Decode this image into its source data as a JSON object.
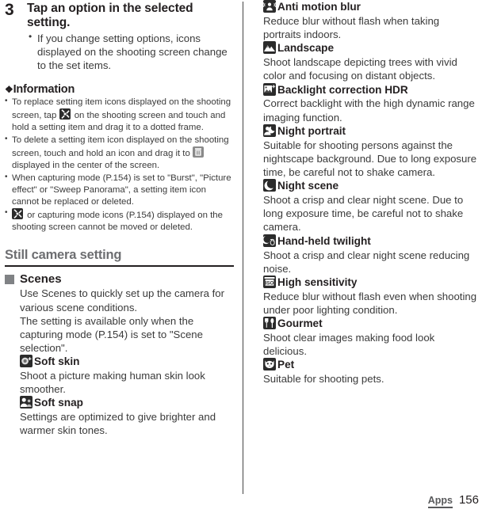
{
  "step": {
    "number": "3",
    "title": "Tap an option in the selected setting.",
    "bullets": [
      "If you change setting options, icons displayed on the shooting screen change to the set items."
    ]
  },
  "information": {
    "heading": "Information",
    "symbol": "❖",
    "bullets": [
      {
        "pre": "To replace setting item icons displayed on the shooting screen, tap ",
        "icon": "tools-icon",
        "post": " on the shooting screen and touch and hold a setting item and drag it to a dotted frame."
      },
      {
        "pre": "To delete a setting item icon displayed on the shooting screen, touch and hold an icon and drag it to ",
        "icon": "trash-icon",
        "post": " displayed in the center of the screen."
      },
      {
        "pre": "When capturing mode (P.154) is set to \"Burst\", \"Picture effect\" or \"Sweep Panorama\", a setting item icon cannot be replaced or deleted.",
        "icon": null,
        "post": ""
      },
      {
        "pre": "",
        "icon": "tools-icon",
        "post": " or capturing mode icons (P.154) displayed on the shooting screen cannot be moved or deleted."
      }
    ]
  },
  "section": {
    "title": "Still camera setting",
    "subsection": {
      "title": "Scenes",
      "paragraphs": [
        "Use Scenes to quickly set up the camera for various scene conditions.",
        "The setting is available only when the capturing mode (P.154) is set to \"Scene selection\"."
      ]
    }
  },
  "scenes_left": [
    {
      "icon": "soft-skin-icon",
      "title": "Soft skin",
      "desc": "Shoot a picture making human skin look smoother."
    },
    {
      "icon": "soft-snap-icon",
      "title": "Soft snap",
      "desc": "Settings are optimized to give brighter and warmer skin tones."
    }
  ],
  "scenes_right": [
    {
      "icon": "anti-motion-blur-icon",
      "title": "Anti motion blur",
      "desc": "Reduce blur without flash when taking portraits indoors."
    },
    {
      "icon": "landscape-icon",
      "title": "Landscape",
      "desc": "Shoot landscape depicting trees with vivid color and focusing on distant objects."
    },
    {
      "icon": "backlight-hdr-icon",
      "title": "Backlight correction HDR",
      "desc": "Correct backlight with the high dynamic range imaging function."
    },
    {
      "icon": "night-portrait-icon",
      "title": "Night portrait",
      "desc": "Suitable for shooting persons against the nightscape background. Due to long exposure time, be careful not to shake camera."
    },
    {
      "icon": "night-scene-icon",
      "title": "Night scene",
      "desc": "Shoot a crisp and clear night scene. Due to long exposure time, be careful not to shake camera."
    },
    {
      "icon": "hand-held-twilight-icon",
      "title": "Hand-held twilight",
      "desc": "Shoot a crisp and clear night scene reducing noise."
    },
    {
      "icon": "high-sensitivity-icon",
      "title": "High sensitivity",
      "desc": "Reduce blur without flash even when shooting under poor lighting condition."
    },
    {
      "icon": "gourmet-icon",
      "title": "Gourmet",
      "desc": "Shoot clear images making food look delicious."
    },
    {
      "icon": "pet-icon",
      "title": "Pet",
      "desc": "Suitable for shooting pets."
    }
  ],
  "footer": {
    "tab": "Apps",
    "page": "156"
  }
}
